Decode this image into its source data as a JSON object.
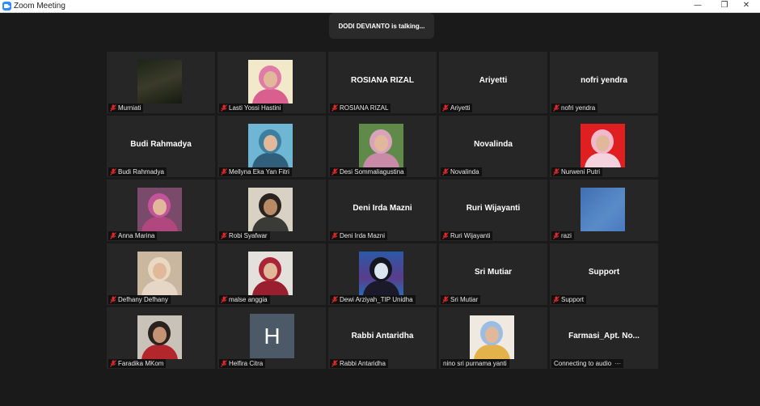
{
  "window": {
    "title": "Zoom Meeting",
    "minimize": "—",
    "restore": "❐",
    "close": "✕"
  },
  "speaker_banner": "DODI DEVIANTO is talking...",
  "colors": {
    "background": "#1a1a1a",
    "tile": "#262626",
    "mute": "#e02828"
  },
  "participants": [
    {
      "name": "Murniati",
      "display": "",
      "media": "video"
    },
    {
      "name": "Lasti Yossi Hastini",
      "display": "",
      "media": "photo"
    },
    {
      "name": "ROSIANA RIZAL",
      "display": "ROSIANA RIZAL",
      "media": "name"
    },
    {
      "name": "Ariyetti",
      "display": "Ariyetti",
      "media": "name"
    },
    {
      "name": "nofri yendra",
      "display": "nofri yendra",
      "media": "name"
    },
    {
      "name": "Budi Rahmadya",
      "display": "Budi Rahmadya",
      "media": "name"
    },
    {
      "name": "Mellyna Eka Yan Fitri",
      "display": "",
      "media": "photo"
    },
    {
      "name": "Desi Sommaliagustina",
      "display": "",
      "media": "photo"
    },
    {
      "name": "Novalinda",
      "display": "Novalinda",
      "media": "name"
    },
    {
      "name": "Nurweni Putri",
      "display": "",
      "media": "photo"
    },
    {
      "name": "Anna Marina",
      "display": "",
      "media": "photo"
    },
    {
      "name": "Robi Syafwar",
      "display": "",
      "media": "photo"
    },
    {
      "name": "Deni Irda Mazni",
      "display": "Deni Irda Mazni",
      "media": "name"
    },
    {
      "name": "Ruri Wijayanti",
      "display": "Ruri Wijayanti",
      "media": "name"
    },
    {
      "name": "razi",
      "display": "",
      "media": "photo"
    },
    {
      "name": "Defhany Defhany",
      "display": "",
      "media": "photo"
    },
    {
      "name": "malse anggia",
      "display": "",
      "media": "photo"
    },
    {
      "name": "Dewi Arziyah_TIP Unidha",
      "display": "",
      "media": "photo"
    },
    {
      "name": "Sri Mutiar",
      "display": "Sri Mutiar",
      "media": "name"
    },
    {
      "name": "Support",
      "display": "Support",
      "media": "name"
    },
    {
      "name": "Faradika MKom",
      "display": "",
      "media": "photo"
    },
    {
      "name": "Helfira Citra",
      "display": "",
      "media": "initial",
      "initial": "H"
    },
    {
      "name": "Rabbi Antaridha",
      "display": "Rabbi Antaridha",
      "media": "name"
    },
    {
      "name": "nino sri purnama yanti",
      "display": "",
      "media": "photo"
    },
    {
      "name": "Connecting to audio",
      "display": "Farmasi_Apt.  No...",
      "media": "name"
    }
  ]
}
